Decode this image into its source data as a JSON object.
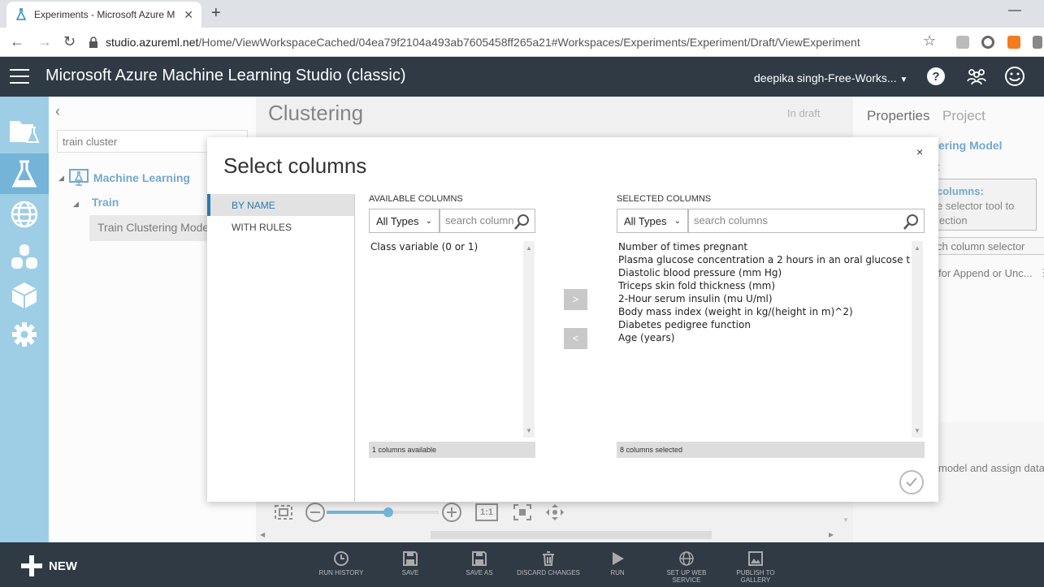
{
  "browser": {
    "tab_title": "Experiments - Microsoft Azure M",
    "url_host": "studio.azureml.net",
    "url_path": "/Home/ViewWorkspaceCached/04ea79f2104a493ab7605458ff265a21#Workspaces/Experiments/Experiment/Draft/ViewExperiment"
  },
  "app": {
    "title": "Microsoft Azure Machine Learning Studio (classic)",
    "workspace": "deepika singh-Free-Works...",
    "header_color": "#2f3a45",
    "rail_color": "#6ab4d8",
    "accent": "#2a7ab4"
  },
  "palette": {
    "search_value": "train cluster",
    "tree": {
      "level1": "Machine Learning",
      "level2": "Train",
      "level3": "Train Clustering Model"
    }
  },
  "canvas": {
    "title": "Clustering",
    "status": "In draft"
  },
  "properties": {
    "tab_properties": "Properties",
    "tab_project": "Project",
    "fragments": {
      "module": "ering Model",
      "t": "t",
      "columns": "columns:",
      "selector": "e selector tool to",
      "lection": "lection",
      "launch": "ch column selector",
      "append": "for Append or Unc...",
      "desc": "model and assign data"
    }
  },
  "dialog": {
    "title": "Select columns",
    "nav": [
      "BY NAME",
      "WITH RULES"
    ],
    "available": {
      "label": "AVAILABLE COLUMNS",
      "type": "All Types",
      "search_placeholder": "search columns",
      "items": [
        "Class variable (0 or 1)"
      ],
      "footer": "1 columns available"
    },
    "selected": {
      "label": "SELECTED COLUMNS",
      "type": "All Types",
      "search_placeholder": "search columns",
      "items": [
        "Number of times pregnant",
        "Plasma glucose concentration a 2 hours in an oral glucose t",
        "Diastolic blood pressure (mm Hg)",
        "Triceps skin fold thickness (mm)",
        "2-Hour serum insulin (mu U/ml)",
        "Body mass index (weight in kg/(height in m)^2)",
        "Diabetes pedigree function",
        "Age (years)"
      ],
      "footer": "8 columns selected"
    },
    "add_label": ">",
    "remove_label": "<",
    "close_label": "×"
  },
  "zoom": {
    "level": 0.55,
    "fit_label": "1:1"
  },
  "commands": {
    "new_label": "NEW",
    "items": [
      "RUN HISTORY",
      "SAVE",
      "SAVE AS",
      "DISCARD CHANGES",
      "RUN",
      "SET UP WEB SERVICE",
      "PUBLISH TO GALLERY"
    ]
  }
}
